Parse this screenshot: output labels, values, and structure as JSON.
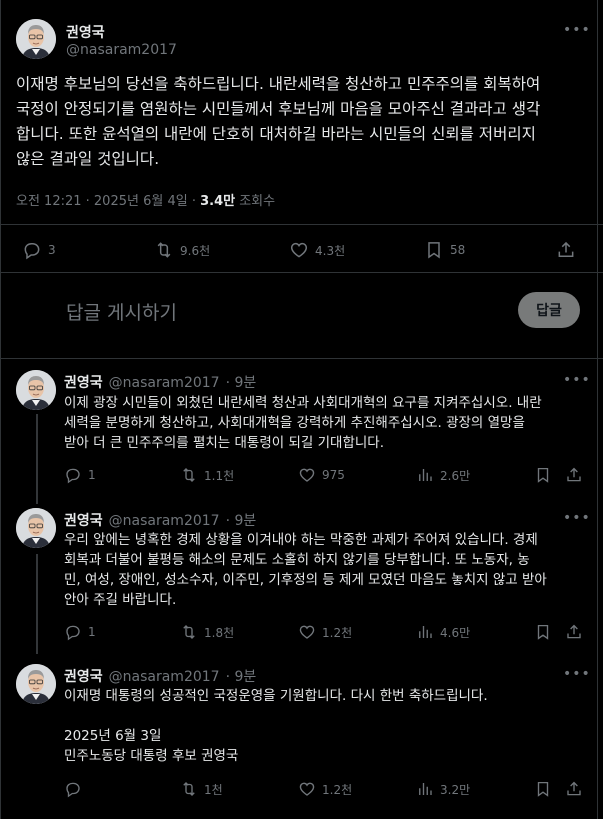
{
  "main_tweet": {
    "name": "권영국",
    "handle": "@nasaram2017",
    "text": "이재명 후보님의 당선을 축하드립니다. 내란세력을 청산하고 민주주의를 회복하여\n국정이 안정되기를 염원하는 시민들께서 후보님께 마음을 모아주신 결과라고 생각\n합니다. 또한 윤석열의 내란에 단호히 대처하길 바라는 시민들의 신뢰를 저버리지\n않은 결과일 것입니다.",
    "time": "오전 12:21 · 2025년 6월 4일 · ",
    "views": "3.4만",
    "views_label": " 조회수",
    "replies": "3",
    "retweets": "9.6천",
    "likes": "4.3천",
    "bookmarks": "58"
  },
  "reply_composer": {
    "placeholder": "답글 게시하기",
    "button": "답글"
  },
  "thread": [
    {
      "name": "권영국",
      "handle": "@nasaram2017",
      "time": "· 9분",
      "text": "이제 광장 시민들이 외쳤던 내란세력 청산과 사회대개혁의 요구를 지켜주십시오. 내란\n세력을 분명하게 청산하고, 사회대개혁을 강력하게 추진해주십시오. 광장의 열망을\n받아 더 큰 민주주의를 펼치는 대통령이 되길 기대합니다.",
      "replies": "1",
      "retweets": "1.1천",
      "likes": "975",
      "views": "2.6만"
    },
    {
      "name": "권영국",
      "handle": "@nasaram2017",
      "time": "· 9분",
      "text": "우리 앞에는 녕혹한 경제 상황을 이겨내야 하는 막중한 과제가 주어져 있습니다. 경제\n회복과 더불어 불평등 해소의 문제도 소홀히 하지 않기를 당부합니다. 또 노동자, 농\n민, 여성, 장애인, 성소수자, 이주민, 기후정의 등 제게 모였던 마음도 놓치지 않고 받아\n안아 주길 바랍니다.",
      "replies": "1",
      "retweets": "1.8천",
      "likes": "1.2천",
      "views": "4.6만"
    },
    {
      "name": "권영국",
      "handle": "@nasaram2017",
      "time": "· 9분",
      "text": "이재명 대통령의 성공적인 국정운영을 기원합니다. 다시 한번 축하드립니다.\n\n2025년 6월 3일\n민주노동당 대통령 후보 권영국",
      "replies": "",
      "retweets": "1천",
      "likes": "1.2천",
      "views": "3.2만"
    }
  ],
  "icons": [
    "more-icon",
    "reply-icon",
    "retweet-icon",
    "like-icon",
    "bookmark-icon",
    "share-icon",
    "views-icon"
  ],
  "colors": {
    "background": "#000000",
    "text": "#e7e9ea",
    "muted": "#71767b",
    "border": "#2f3336",
    "button": "#787a7a"
  }
}
